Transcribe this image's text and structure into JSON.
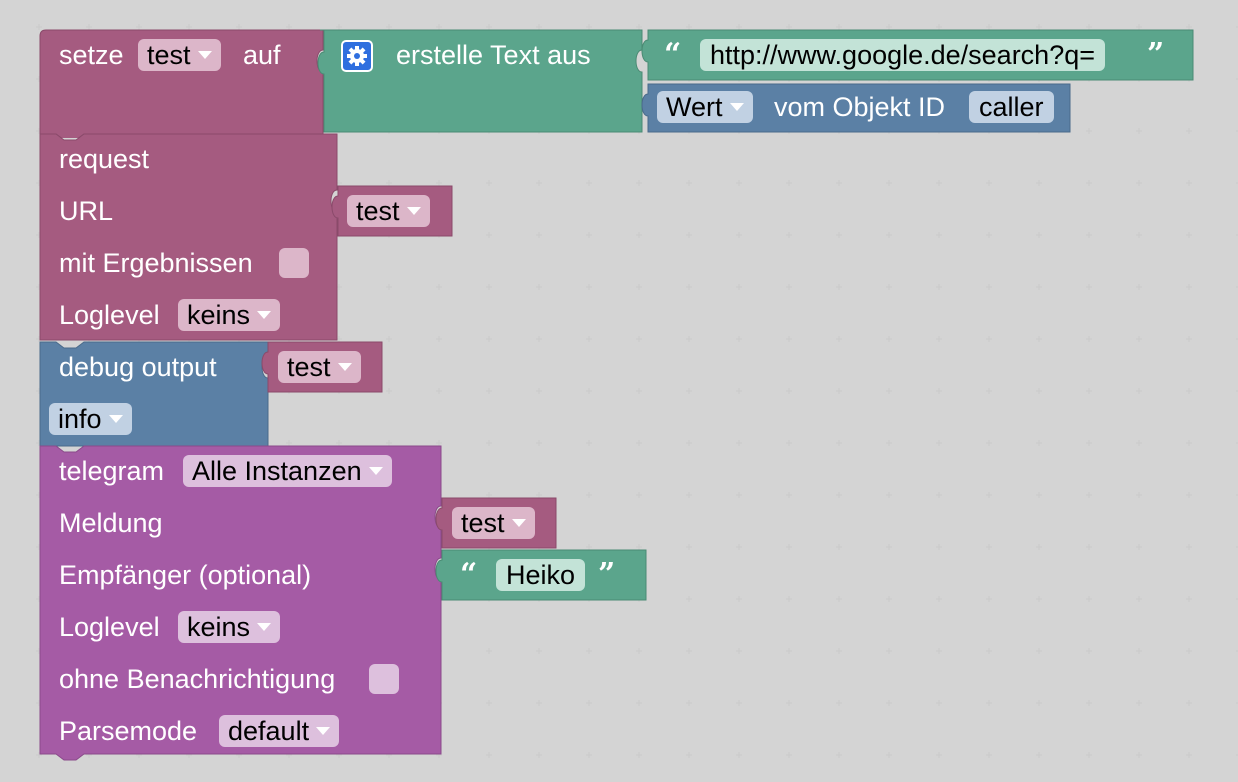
{
  "set_block": {
    "label_setze": "setze",
    "var_name": "test",
    "label_auf": "auf"
  },
  "text_join": {
    "label": "erstelle Text aus",
    "string_value": "http://www.google.de/search?q=",
    "value_dropdown": "Wert",
    "label_vom": "vom Objekt ID",
    "object_id": "caller"
  },
  "request_block": {
    "label_request": "request",
    "label_url": "URL",
    "url_var": "test",
    "label_results": "mit Ergebnissen",
    "label_loglevel": "Loglevel",
    "loglevel_value": "keins"
  },
  "debug_block": {
    "label": "debug output",
    "var": "test",
    "level": "info"
  },
  "telegram_block": {
    "label": "telegram",
    "instance": "Alle Instanzen",
    "label_message": "Meldung",
    "message_var": "test",
    "label_receiver": "Empfänger (optional)",
    "receiver_value": "Heiko",
    "label_loglevel": "Loglevel",
    "loglevel_value": "keins",
    "label_silent": "ohne Benachrichtigung",
    "label_parsemode": "Parsemode",
    "parsemode_value": "default"
  },
  "colors": {
    "variable_block": "#a55b80",
    "variable_field": "#dcb6c9",
    "text_block": "#5ba58c",
    "text_field": "#c3e3d7",
    "sensor_block": "#5b80a5",
    "sensor_field": "#c1d1e3",
    "telegram_block": "#a55ba5",
    "telegram_field": "#ddc0dd"
  },
  "icons": {
    "gear": "gear-icon",
    "dropdown": "chevron-down-icon",
    "quote_open": "quote-open-icon",
    "quote_close": "quote-close-icon"
  }
}
